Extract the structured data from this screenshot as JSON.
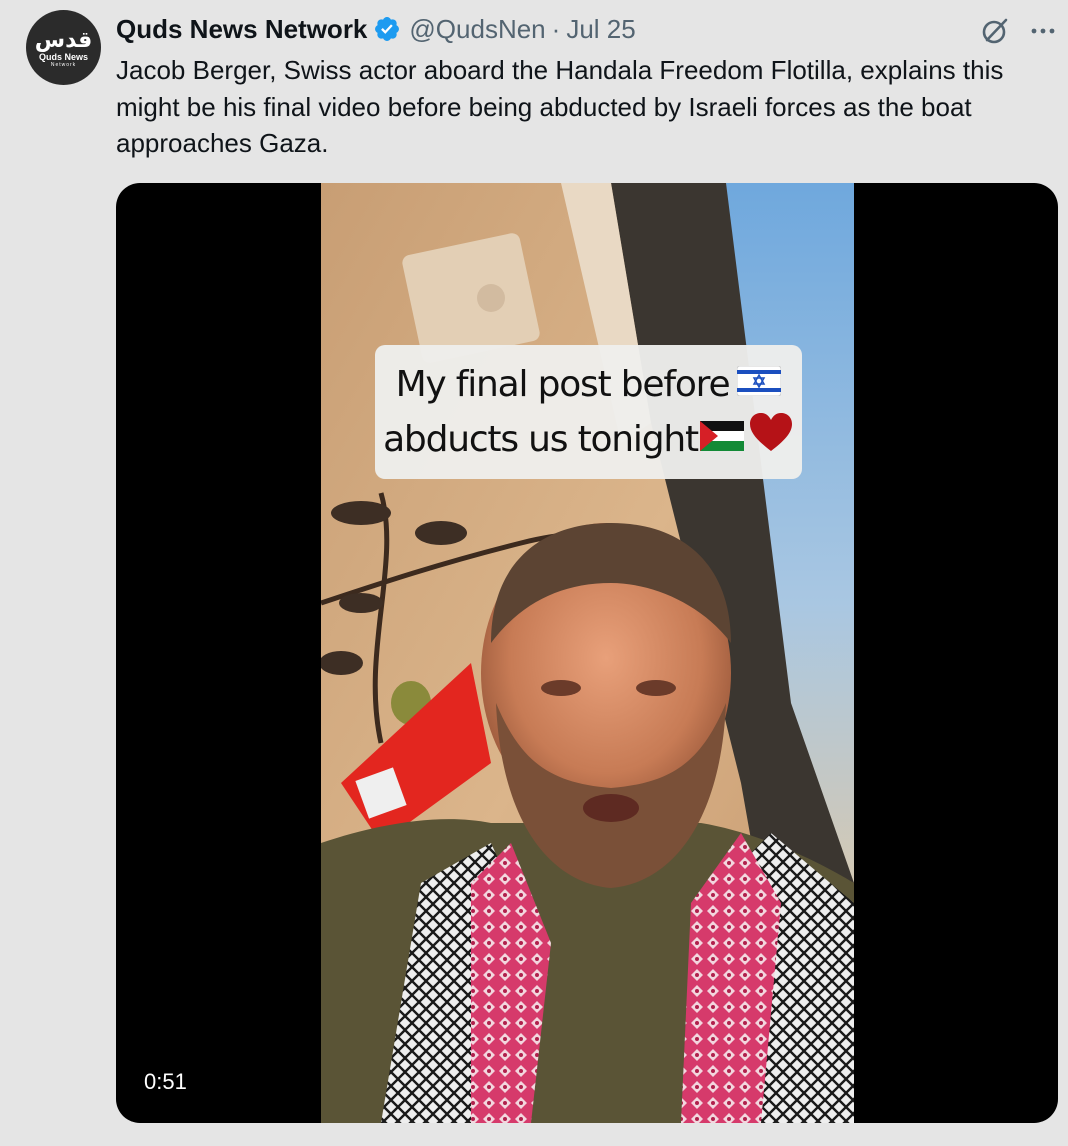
{
  "tweet": {
    "avatar": {
      "logo_text": "قدس",
      "logo_name": "Quds News",
      "logo_sub": "Network"
    },
    "author": {
      "display_name": "Quds News Network",
      "handle": "@QudsNen",
      "separator": "·",
      "date": "Jul 25",
      "verified": true,
      "verified_color": "#1d9bf0"
    },
    "icons": {
      "verified": "verified-badge-icon",
      "grok": "grok-icon",
      "more": "more-dots-icon"
    },
    "text": "Jacob Berger, Swiss actor aboard the Handala Freedom Flotilla, explains this might be his final video before being abducted by Israeli forces as the boat approaches Gaza.",
    "media": {
      "type": "video",
      "caption_line1": "My final post before",
      "caption_line2": "abducts us tonight",
      "caption_emoji": [
        "israel-flag-icon",
        "palestine-flag-icon",
        "red-heart-icon"
      ],
      "duration": "0:51"
    }
  },
  "colors": {
    "background": "#e5e5e5",
    "text_primary": "#0f1419",
    "text_secondary": "#536471",
    "accent": "#1d9bf0"
  }
}
